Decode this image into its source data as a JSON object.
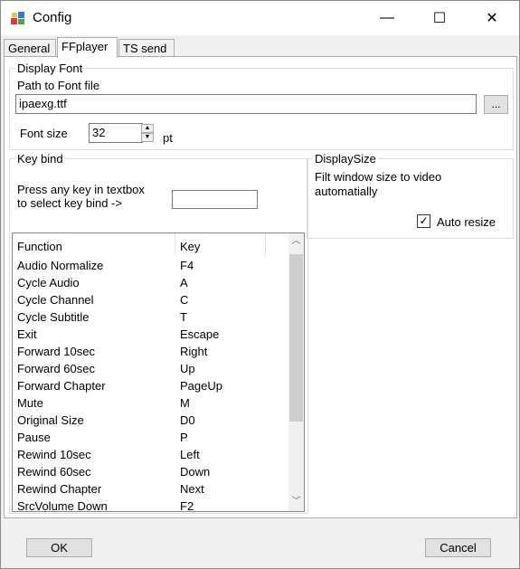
{
  "window": {
    "title": "Config",
    "minimize_glyph": "—",
    "maximize_glyph": "☐",
    "close_glyph": "✕"
  },
  "tabs": [
    {
      "label": "General"
    },
    {
      "label": "FFplayer"
    },
    {
      "label": "TS send"
    }
  ],
  "display_font": {
    "legend": "Display Font",
    "path_label": "Path to Font file",
    "path_value": "ipaexg.ttf",
    "browse_label": "...",
    "font_size_label": "Font size",
    "font_size_value": "32",
    "font_size_unit": "pt"
  },
  "key_bind": {
    "legend": "Key bind",
    "instruction_line1": "Press any key in textbox",
    "instruction_line2": "to select key bind ->",
    "key_input_value": "",
    "columns": [
      "Function",
      "Key"
    ],
    "rows": [
      [
        "Audio Normalize",
        "F4"
      ],
      [
        "Cycle Audio",
        "A"
      ],
      [
        "Cycle Channel",
        "C"
      ],
      [
        "Cycle Subtitle",
        "T"
      ],
      [
        "Exit",
        "Escape"
      ],
      [
        "Forward 10sec",
        "Right"
      ],
      [
        "Forward 60sec",
        "Up"
      ],
      [
        "Forward Chapter",
        "PageUp"
      ],
      [
        "Mute",
        "M"
      ],
      [
        "Original Size",
        "D0"
      ],
      [
        "Pause",
        "P"
      ],
      [
        "Rewind 10sec",
        "Left"
      ],
      [
        "Rewind 60sec",
        "Down"
      ],
      [
        "Rewind Chapter",
        "Next"
      ],
      [
        "SrcVolume Down",
        "F2"
      ]
    ]
  },
  "display_size": {
    "legend": "DisplaySize",
    "description_line1": "Filt window size to video",
    "description_line2": "automatially",
    "auto_resize_label": "Auto resize",
    "auto_resize_checked": true
  },
  "footer": {
    "ok_label": "OK",
    "cancel_label": "Cancel"
  }
}
